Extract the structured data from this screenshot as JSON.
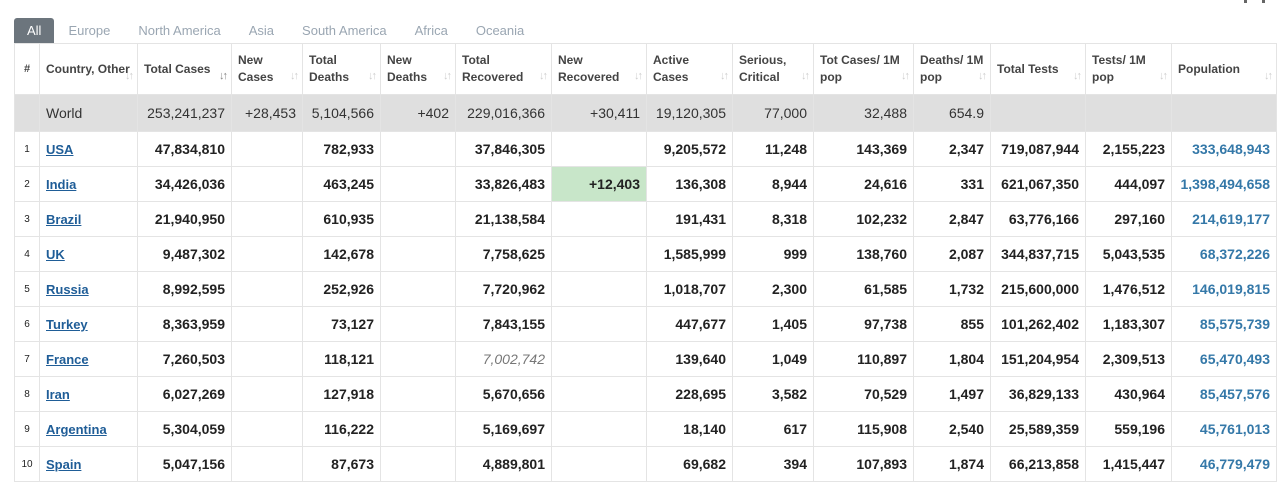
{
  "tabs": [
    "All",
    "Europe",
    "North America",
    "Asia",
    "South America",
    "Africa",
    "Oceania"
  ],
  "columns": [
    {
      "key": "num",
      "label": "#"
    },
    {
      "key": "country",
      "label": "Country, Other"
    },
    {
      "key": "total_cases",
      "label": "Total Cases"
    },
    {
      "key": "new_cases",
      "label": "New Cases"
    },
    {
      "key": "total_deaths",
      "label": "Total Deaths"
    },
    {
      "key": "new_deaths",
      "label": "New Deaths"
    },
    {
      "key": "total_recovered",
      "label": "Total Recovered"
    },
    {
      "key": "new_recovered",
      "label": "New Recovered"
    },
    {
      "key": "active_cases",
      "label": "Active Cases"
    },
    {
      "key": "serious",
      "label": "Serious, Critical"
    },
    {
      "key": "cases_per_1m",
      "label": "Tot Cases/ 1M pop"
    },
    {
      "key": "deaths_per_1m",
      "label": "Deaths/ 1M pop"
    },
    {
      "key": "total_tests",
      "label": "Total Tests"
    },
    {
      "key": "tests_per_1m",
      "label": "Tests/ 1M pop"
    },
    {
      "key": "population",
      "label": "Population"
    }
  ],
  "sort_icon": "↓↑",
  "world": {
    "country": "World",
    "total_cases": "253,241,237",
    "new_cases": "+28,453",
    "total_deaths": "5,104,566",
    "new_deaths": "+402",
    "total_recovered": "229,016,366",
    "new_recovered": "+30,411",
    "active_cases": "19,120,305",
    "serious": "77,000",
    "cases_per_1m": "32,488",
    "deaths_per_1m": "654.9",
    "total_tests": "",
    "tests_per_1m": "",
    "population": ""
  },
  "rows": [
    {
      "num": "1",
      "country": "USA",
      "total_cases": "47,834,810",
      "new_cases": "",
      "total_deaths": "782,933",
      "new_deaths": "",
      "total_recovered": "37,846,305",
      "new_recovered": "",
      "active_cases": "9,205,572",
      "serious": "11,248",
      "cases_per_1m": "143,369",
      "deaths_per_1m": "2,347",
      "total_tests": "719,087,944",
      "tests_per_1m": "2,155,223",
      "population": "333,648,943"
    },
    {
      "num": "2",
      "country": "India",
      "total_cases": "34,426,036",
      "new_cases": "",
      "total_deaths": "463,245",
      "new_deaths": "",
      "total_recovered": "33,826,483",
      "new_recovered": "+12,403",
      "active_cases": "136,308",
      "serious": "8,944",
      "cases_per_1m": "24,616",
      "deaths_per_1m": "331",
      "total_tests": "621,067,350",
      "tests_per_1m": "444,097",
      "population": "1,398,494,658"
    },
    {
      "num": "3",
      "country": "Brazil",
      "total_cases": "21,940,950",
      "new_cases": "",
      "total_deaths": "610,935",
      "new_deaths": "",
      "total_recovered": "21,138,584",
      "new_recovered": "",
      "active_cases": "191,431",
      "serious": "8,318",
      "cases_per_1m": "102,232",
      "deaths_per_1m": "2,847",
      "total_tests": "63,776,166",
      "tests_per_1m": "297,160",
      "population": "214,619,177"
    },
    {
      "num": "4",
      "country": "UK",
      "total_cases": "9,487,302",
      "new_cases": "",
      "total_deaths": "142,678",
      "new_deaths": "",
      "total_recovered": "7,758,625",
      "new_recovered": "",
      "active_cases": "1,585,999",
      "serious": "999",
      "cases_per_1m": "138,760",
      "deaths_per_1m": "2,087",
      "total_tests": "344,837,715",
      "tests_per_1m": "5,043,535",
      "population": "68,372,226"
    },
    {
      "num": "5",
      "country": "Russia",
      "total_cases": "8,992,595",
      "new_cases": "",
      "total_deaths": "252,926",
      "new_deaths": "",
      "total_recovered": "7,720,962",
      "new_recovered": "",
      "active_cases": "1,018,707",
      "serious": "2,300",
      "cases_per_1m": "61,585",
      "deaths_per_1m": "1,732",
      "total_tests": "215,600,000",
      "tests_per_1m": "1,476,512",
      "population": "146,019,815"
    },
    {
      "num": "6",
      "country": "Turkey",
      "total_cases": "8,363,959",
      "new_cases": "",
      "total_deaths": "73,127",
      "new_deaths": "",
      "total_recovered": "7,843,155",
      "new_recovered": "",
      "active_cases": "447,677",
      "serious": "1,405",
      "cases_per_1m": "97,738",
      "deaths_per_1m": "855",
      "total_tests": "101,262,402",
      "tests_per_1m": "1,183,307",
      "population": "85,575,739"
    },
    {
      "num": "7",
      "country": "France",
      "total_cases": "7,260,503",
      "new_cases": "",
      "total_deaths": "118,121",
      "new_deaths": "",
      "total_recovered": "7,002,742",
      "new_recovered": "",
      "active_cases": "139,640",
      "serious": "1,049",
      "cases_per_1m": "110,897",
      "deaths_per_1m": "1,804",
      "total_tests": "151,204,954",
      "tests_per_1m": "2,309,513",
      "population": "65,470,493"
    },
    {
      "num": "8",
      "country": "Iran",
      "total_cases": "6,027,269",
      "new_cases": "",
      "total_deaths": "127,918",
      "new_deaths": "",
      "total_recovered": "5,670,656",
      "new_recovered": "",
      "active_cases": "228,695",
      "serious": "3,582",
      "cases_per_1m": "70,529",
      "deaths_per_1m": "1,497",
      "total_tests": "36,829,133",
      "tests_per_1m": "430,964",
      "population": "85,457,576"
    },
    {
      "num": "9",
      "country": "Argentina",
      "total_cases": "5,304,059",
      "new_cases": "",
      "total_deaths": "116,222",
      "new_deaths": "",
      "total_recovered": "5,169,697",
      "new_recovered": "",
      "active_cases": "18,140",
      "serious": "617",
      "cases_per_1m": "115,908",
      "deaths_per_1m": "2,540",
      "total_tests": "25,589,359",
      "tests_per_1m": "559,196",
      "population": "45,761,013"
    },
    {
      "num": "10",
      "country": "Spain",
      "total_cases": "5,047,156",
      "new_cases": "",
      "total_deaths": "87,673",
      "new_deaths": "",
      "total_recovered": "4,889,801",
      "new_recovered": "",
      "active_cases": "69,682",
      "serious": "394",
      "cases_per_1m": "107,893",
      "deaths_per_1m": "1,874",
      "total_tests": "66,213,858",
      "tests_per_1m": "1,415,447",
      "population": "46,779,479"
    }
  ]
}
